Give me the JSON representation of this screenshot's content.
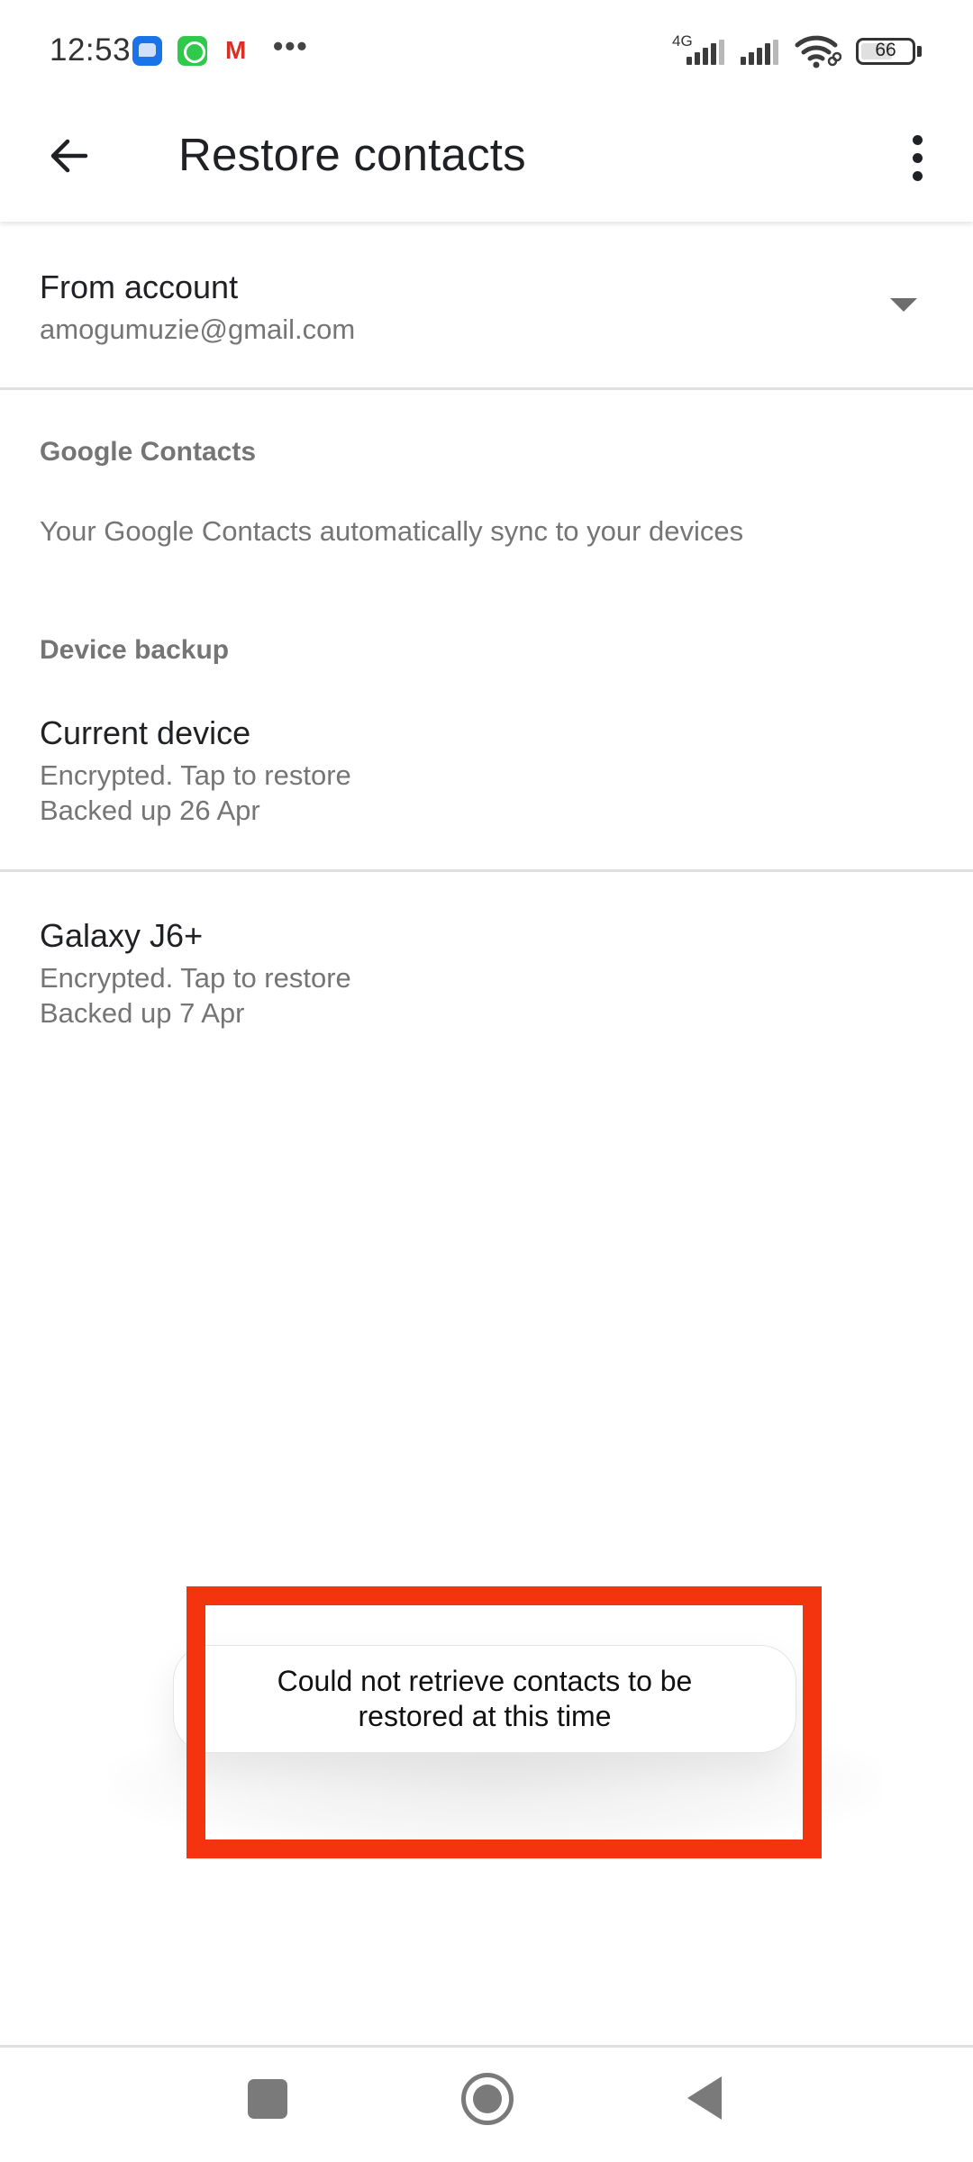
{
  "status_bar": {
    "time": "12:53",
    "notifications": [
      "messages-icon",
      "whatsapp-icon",
      "gmail-icon"
    ],
    "more_indicator": "•••",
    "network_type": "4G",
    "battery_level": "66",
    "battery_percent": 66
  },
  "app_bar": {
    "title": "Restore contacts",
    "back_icon": "arrow-back-icon",
    "menu_icon": "more-vert-icon"
  },
  "account": {
    "label": "From account",
    "email": "amogumuzie@gmail.com"
  },
  "google_contacts": {
    "header": "Google Contacts",
    "description": "Your Google Contacts automatically sync to your devices"
  },
  "device_backup": {
    "header": "Device backup",
    "items": [
      {
        "title": "Current device",
        "status": "Encrypted. Tap to restore",
        "backup_date": "Backed up 26 Apr"
      },
      {
        "title": "Galaxy J6+",
        "status": "Encrypted. Tap to restore",
        "backup_date": "Backed up 7 Apr"
      }
    ]
  },
  "toast": {
    "message": "Could not retrieve contacts to be restored at this time"
  },
  "colors": {
    "highlight": "#f4340f",
    "text_primary": "#202124",
    "text_secondary": "#757575"
  },
  "nav_bar": {
    "buttons": [
      "recents-icon",
      "home-icon",
      "back-icon"
    ]
  }
}
